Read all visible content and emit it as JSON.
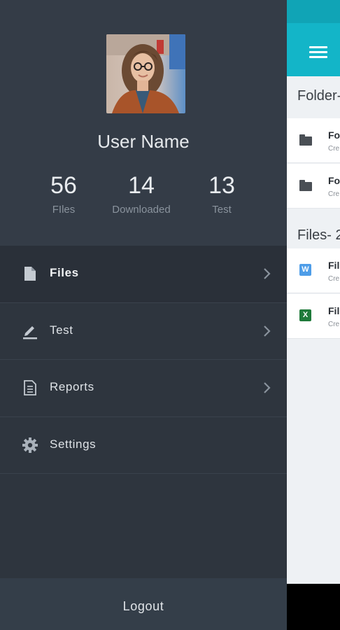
{
  "drawer": {
    "user_name": "User Name",
    "stats": [
      {
        "value": "56",
        "label": "FIles"
      },
      {
        "value": "14",
        "label": "Downloaded"
      },
      {
        "value": "13",
        "label": "Test"
      }
    ],
    "menu": [
      {
        "label": "Files",
        "icon": "file-icon",
        "active": true
      },
      {
        "label": "Test",
        "icon": "pencil-icon",
        "active": false
      },
      {
        "label": "Reports",
        "icon": "document-icon",
        "active": false
      },
      {
        "label": "Settings",
        "icon": "gear-icon",
        "active": false
      }
    ],
    "logout_label": "Logout"
  },
  "app": {
    "folders_title": "Folder-",
    "files_title": "Files- 2",
    "folders": [
      {
        "name": "Fol",
        "meta": "Cre"
      },
      {
        "name": "Fol",
        "meta": "Cre"
      }
    ],
    "files": [
      {
        "name": "File",
        "meta": "Cre",
        "badge": "W"
      },
      {
        "name": "File",
        "meta": "Cre",
        "badge": "X"
      }
    ]
  },
  "colors": {
    "drawer_bg": "#2e353e",
    "profile_bg": "#343c47",
    "accent_toolbar": "#13b5c8",
    "word_badge": "#4e9de8",
    "excel_badge": "#1f7a3a"
  }
}
